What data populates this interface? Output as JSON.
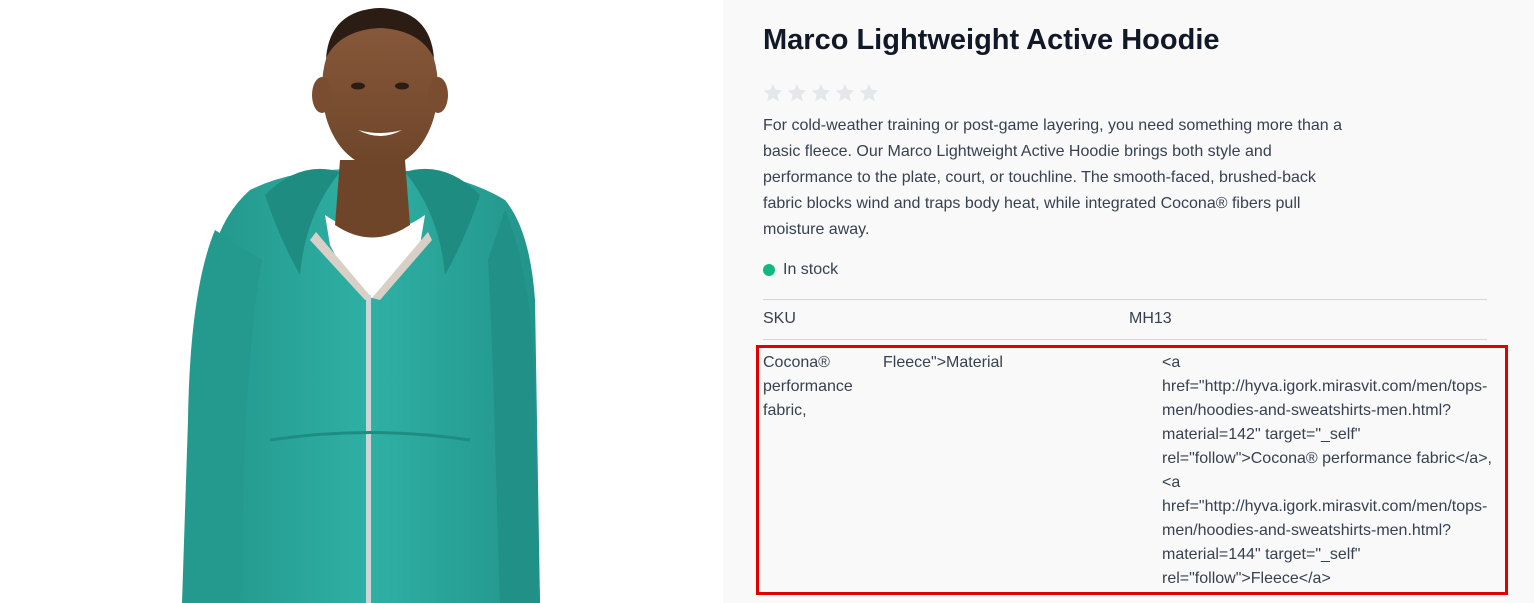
{
  "product": {
    "name": "Marco Lightweight Active Hoodie",
    "rating": {
      "value": 0,
      "max": 5
    },
    "description": "For cold-weather training or post-game layering, you need something more than a basic fleece. Our Marco Lightweight Active Hoodie brings both style and performance to the plate, court, or touchline. The smooth-faced, brushed-back fabric blocks wind and traps body heat, while integrated Cocona® fibers pull moisture away.",
    "stock_status": "In stock",
    "stock_color": "#10b981"
  },
  "attributes": {
    "sku_label": "SKU",
    "sku_value": "MH13",
    "material_row": {
      "col1": "Cocona® performance fabric,",
      "col2": "Fleece\">Material",
      "col3": "<a href=\"http://hyva.igork.mirasvit.com/men/tops-men/hoodies-and-sweatshirts-men.html?material=142\" target=\"_self\" rel=\"follow\">Cocona® performance fabric</a>, <a href=\"http://hyva.igork.mirasvit.com/men/tops-men/hoodies-and-sweatshirts-men.html?material=144\" target=\"_self\" rel=\"follow\">Fleece</a>"
    }
  },
  "colors": {
    "hoodie": "#2aa59a",
    "highlight_border": "#e00000",
    "panel_bg": "#f9f9f9"
  }
}
